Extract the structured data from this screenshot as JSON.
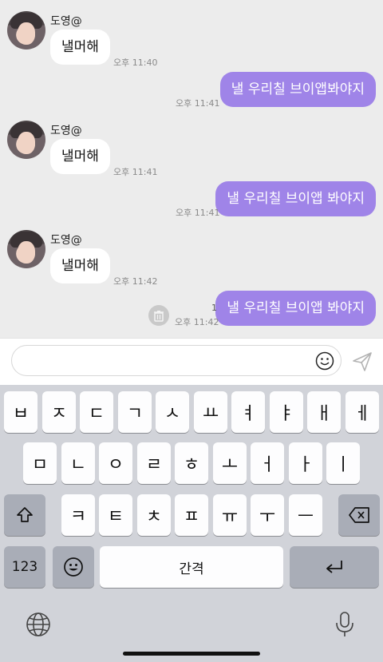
{
  "messages_in": [
    {
      "sender": "도영@",
      "text": "낼머해",
      "time": "오후 11:40"
    },
    {
      "sender": "도영@",
      "text": "낼머해",
      "time": "오후 11:41"
    },
    {
      "sender": "도영@",
      "text": "낼머해",
      "time": "오후 11:42"
    }
  ],
  "messages_out": [
    {
      "text": "낼 우리칠 브이앱봐야지",
      "time": "오후 11:41"
    },
    {
      "text": "낼 우리칠 브이앱 봐야지",
      "time": "오후 11:41"
    },
    {
      "text": "낼 우리칠 브이앱 봐야지",
      "time": "오후 11:42",
      "unread": "1"
    }
  ],
  "input": {
    "placeholder": ""
  },
  "keyboard": {
    "row1": [
      "ㅂ",
      "ㅈ",
      "ㄷ",
      "ㄱ",
      "ㅅ",
      "ㅛ",
      "ㅕ",
      "ㅑ",
      "ㅐ",
      "ㅔ"
    ],
    "row2": [
      "ㅁ",
      "ㄴ",
      "ㅇ",
      "ㄹ",
      "ㅎ",
      "ㅗ",
      "ㅓ",
      "ㅏ",
      "ㅣ"
    ],
    "row3": [
      "ㅋ",
      "ㅌ",
      "ㅊ",
      "ㅍ",
      "ㅠ",
      "ㅜ",
      "ㅡ"
    ],
    "numbers_label": "123",
    "space_label": "간격"
  },
  "icons": {
    "shift": "shift-icon",
    "backspace": "backspace-icon",
    "emoji": "emoji-icon",
    "return": "return-icon",
    "globe": "globe-icon",
    "mic": "mic-icon",
    "send": "send-icon",
    "trash": "trash-icon"
  },
  "colors": {
    "outgoing_bubble": "#9f84e8",
    "incoming_bubble": "#ffffff",
    "chat_background": "#ececec",
    "keyboard_background": "#d1d3d9"
  }
}
